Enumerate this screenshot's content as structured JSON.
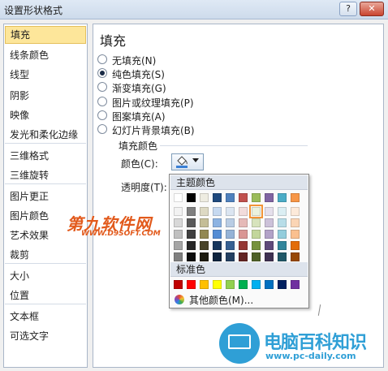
{
  "window": {
    "title": "设置形状格式",
    "help_label": "?",
    "close_label": "✕"
  },
  "sidebar": {
    "items": [
      {
        "label": "填充",
        "active": true
      },
      {
        "label": "线条颜色"
      },
      {
        "label": "线型"
      },
      {
        "label": "阴影"
      },
      {
        "label": "映像"
      },
      {
        "label": "发光和柔化边缘"
      },
      {
        "label": "三维格式"
      },
      {
        "label": "三维旋转"
      },
      {
        "label": "图片更正"
      },
      {
        "label": "图片颜色"
      },
      {
        "label": "艺术效果"
      },
      {
        "label": "裁剪"
      },
      {
        "label": "大小"
      },
      {
        "label": "位置"
      },
      {
        "label": "文本框"
      },
      {
        "label": "可选文字"
      }
    ]
  },
  "fill_panel": {
    "title": "填充",
    "options": [
      {
        "label": "无填充(N)",
        "checked": false
      },
      {
        "label": "纯色填充(S)",
        "checked": true
      },
      {
        "label": "渐变填充(G)",
        "checked": false
      },
      {
        "label": "图片或纹理填充(P)",
        "checked": false
      },
      {
        "label": "图案填充(A)",
        "checked": false
      },
      {
        "label": "幻灯片背景填充(B)",
        "checked": false
      }
    ],
    "group_label": "填充颜色",
    "color_label": "颜色(C):",
    "transparency_label": "透明度(T):",
    "bucket_color": "#3a7fd5"
  },
  "color_picker": {
    "theme_header": "主题颜色",
    "standard_header": "标准色",
    "more_colors_label": "其他颜色(M)...",
    "theme_top": [
      "#ffffff",
      "#000000",
      "#eeece1",
      "#1f497d",
      "#4f81bd",
      "#c0504d",
      "#9bbb59",
      "#8064a2",
      "#4bacc6",
      "#f79646"
    ],
    "theme_shades": [
      [
        "#f2f2f2",
        "#7f7f7f",
        "#ddd9c3",
        "#c6d9f0",
        "#dbe5f1",
        "#f2dcdb",
        "#ebf1dd",
        "#e5e0ec",
        "#dbeef3",
        "#fdeada"
      ],
      [
        "#d8d8d8",
        "#595959",
        "#c4bd97",
        "#8db3e2",
        "#b8cce4",
        "#e5b9b7",
        "#d7e3bc",
        "#ccc1d9",
        "#b7dde8",
        "#fbd5b5"
      ],
      [
        "#bfbfbf",
        "#3f3f3f",
        "#938953",
        "#548dd4",
        "#95b3d7",
        "#d99694",
        "#c3d69b",
        "#b2a2c7",
        "#92cddc",
        "#fac08f"
      ],
      [
        "#a5a5a5",
        "#262626",
        "#494429",
        "#17365d",
        "#366092",
        "#953734",
        "#76923c",
        "#5f497a",
        "#31859b",
        "#e36c09"
      ],
      [
        "#7f7f7f",
        "#0c0c0c",
        "#1d1b10",
        "#0f243e",
        "#244061",
        "#632423",
        "#4f6128",
        "#3f3151",
        "#205867",
        "#974806"
      ]
    ],
    "standard": [
      "#c00000",
      "#ff0000",
      "#ffc000",
      "#ffff00",
      "#92d050",
      "#00b050",
      "#00b0f0",
      "#0070c0",
      "#002060",
      "#7030a0"
    ],
    "selected_index": [
      0,
      6
    ]
  },
  "watermarks": {
    "site1_name": "第九软件网",
    "site1_url": "WWW.D9SOFT.COM",
    "site2_name": "电脑百科知识",
    "site2_url": "www.pc-daily.com"
  }
}
